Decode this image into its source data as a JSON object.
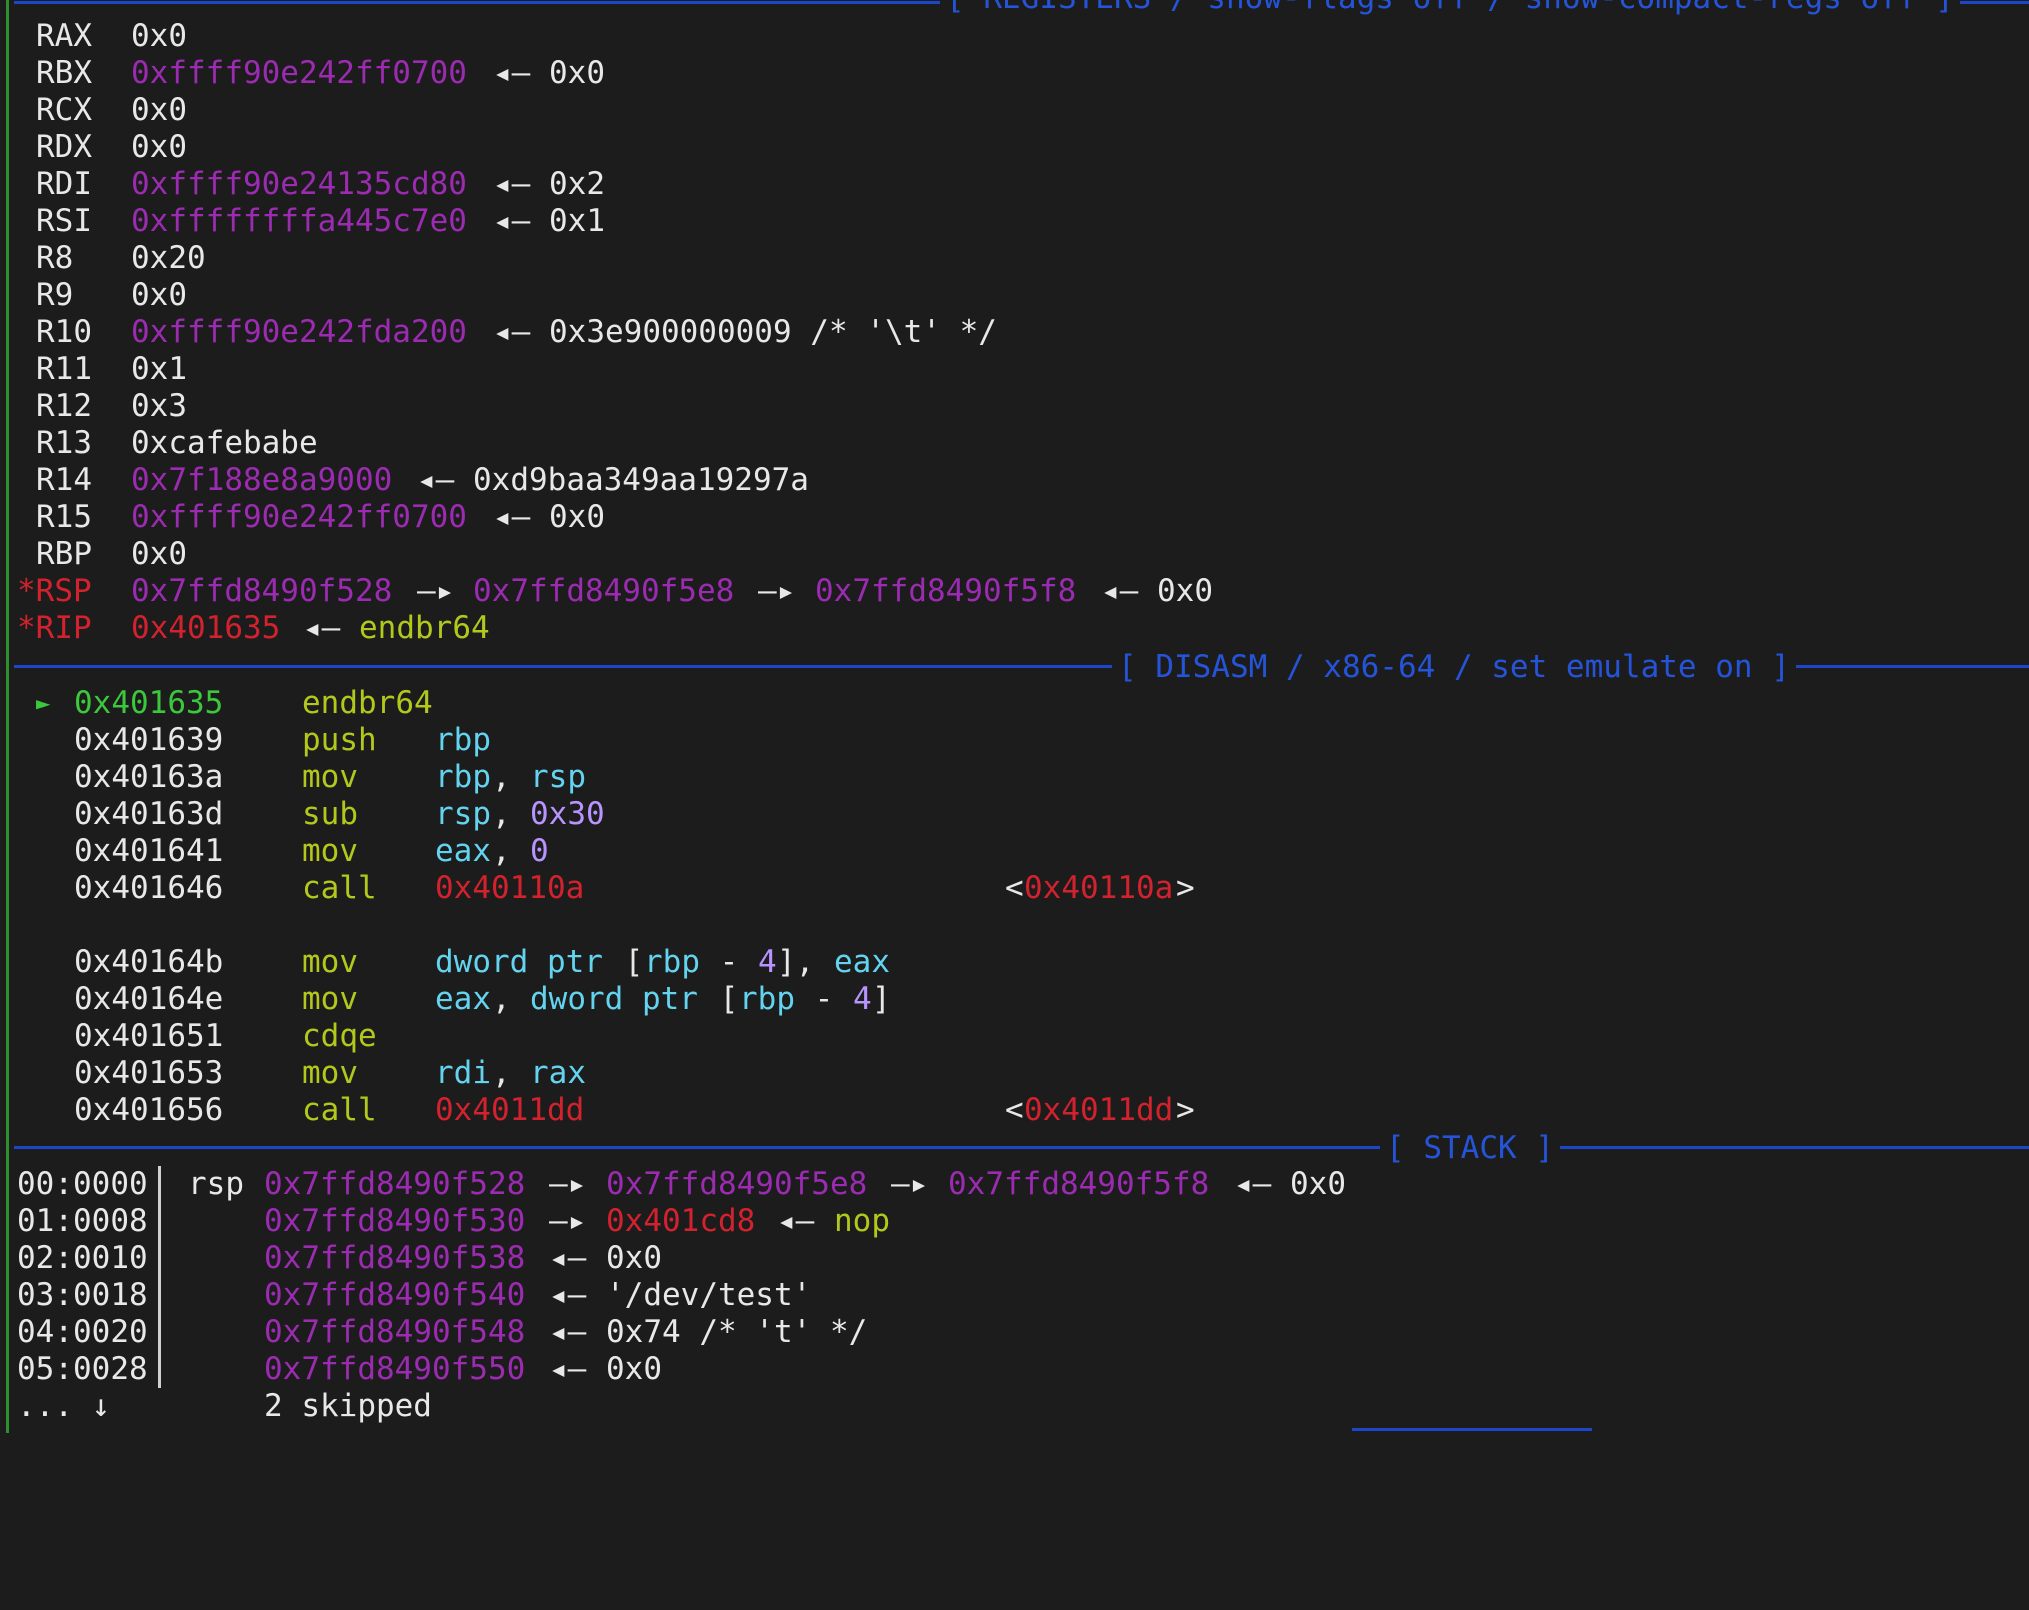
{
  "headers": {
    "registers": "[ REGISTERS / show-flags off / show-compact-regs off ]",
    "disasm": "[ DISASM / x86-64 / set emulate on ]",
    "stack": "[ STACK ]"
  },
  "registers": [
    {
      "name": "RAX",
      "value": "0x0"
    },
    {
      "name": "RBX",
      "value": "0xffff90e242ff0700",
      "arrow1": "◂—",
      "target": "0x0"
    },
    {
      "name": "RCX",
      "value": "0x0"
    },
    {
      "name": "RDX",
      "value": "0x0"
    },
    {
      "name": "RDI",
      "value": "0xffff90e24135cd80",
      "arrow1": "◂—",
      "target": "0x2"
    },
    {
      "name": "RSI",
      "value": "0xffffffffa445c7e0",
      "arrow1": "◂—",
      "target": "0x1"
    },
    {
      "name": "R8",
      "value": "0x20"
    },
    {
      "name": "R9",
      "value": "0x0"
    },
    {
      "name": "R10",
      "value": "0xffff90e242fda200",
      "arrow1": "◂—",
      "target": "0x3e900000009 /* '\\t' */"
    },
    {
      "name": "R11",
      "value": "0x1"
    },
    {
      "name": "R12",
      "value": "0x3"
    },
    {
      "name": "R13",
      "value": "0xcafebabe"
    },
    {
      "name": "R14",
      "value": "0x7f188e8a9000",
      "arrow1": "◂—",
      "target": "0xd9baa349aa19297a"
    },
    {
      "name": "R15",
      "value": "0xffff90e242ff0700",
      "arrow1": "◂—",
      "target": "0x0"
    },
    {
      "name": "RBP",
      "value": "0x0"
    },
    {
      "name": "*RSP",
      "value": "0x7ffd8490f528",
      "arrow1": "—▸",
      "ptr2": "0x7ffd8490f5e8",
      "arrow2": "—▸",
      "ptr3": "0x7ffd8490f5f8",
      "arrow3": "◂—",
      "target": "0x0"
    },
    {
      "name": "*RIP",
      "value": "0x401635",
      "arrow1": "◂—",
      "target": "endbr64"
    }
  ],
  "disasm": {
    "marker": "►",
    "lines": [
      {
        "addr": "0x401635",
        "mnem": "endbr64",
        "op1": "",
        "op1b": "",
        "op2": "",
        "op2b": "",
        "op3": "",
        "comment_open": "",
        "comment_addr": "",
        "comment_close": ""
      },
      {
        "addr": "0x401639",
        "mnem": "push",
        "op1": "rbp"
      },
      {
        "addr": "0x40163a",
        "mnem": "mov",
        "op1": "rbp",
        "sep": ", ",
        "op2": "rsp"
      },
      {
        "addr": "0x40163d",
        "mnem": "sub",
        "op1": "rsp",
        "sep": ", ",
        "num": "0x30"
      },
      {
        "addr": "0x401641",
        "mnem": "mov",
        "op1": "eax",
        "sep": ", ",
        "num": "0"
      },
      {
        "addr": "0x401646",
        "mnem": "call",
        "call": "0x40110a",
        "comment_open": "<",
        "comment_addr": "0x40110a",
        "comment_close": ">"
      },
      {
        "addr": "0x40164b",
        "mnem": "mov",
        "mem1": "dword ptr",
        "br_open": " [",
        "reg_in": "rbp",
        "minus": " - ",
        "off": "4",
        "br_close": "], ",
        "op2": "eax"
      },
      {
        "addr": "0x40164e",
        "mnem": "mov",
        "op1": "eax",
        "sep": ", ",
        "mem1": "dword ptr",
        "br_open": " [",
        "reg_in": "rbp",
        "minus": " - ",
        "off": "4",
        "br_close": "]"
      },
      {
        "addr": "0x401651",
        "mnem": "cdqe"
      },
      {
        "addr": "0x401653",
        "mnem": "mov",
        "op1": "rdi",
        "sep": ", ",
        "op2": "rax"
      },
      {
        "addr": "0x401656",
        "mnem": "call",
        "call": "0x4011dd",
        "comment_open": "<",
        "comment_addr": "0x4011dd",
        "comment_close": ">"
      }
    ]
  },
  "stack": {
    "rows": [
      {
        "idx": "00:0000",
        "label": "rsp",
        "addr": "0x7ffd8490f528",
        "a1": "—▸",
        "p2": "0x7ffd8490f5e8",
        "a2": "—▸",
        "p3": "0x7ffd8490f5f8",
        "a3": "◂—",
        "val": "0x0"
      },
      {
        "idx": "01:0008",
        "label": "",
        "addr": "0x7ffd8490f530",
        "a1": "—▸",
        "p2red": "0x401cd8",
        "a2": "◂—",
        "valyellow": "nop"
      },
      {
        "idx": "02:0010",
        "label": "",
        "addr": "0x7ffd8490f538",
        "a1": "◂—",
        "val": "0x0"
      },
      {
        "idx": "03:0018",
        "label": "",
        "addr": "0x7ffd8490f540",
        "a1": "◂—",
        "val": "'/dev/test'"
      },
      {
        "idx": "04:0020",
        "label": "",
        "addr": "0x7ffd8490f548",
        "a1": "◂—",
        "val": "0x74 /* 't' */"
      },
      {
        "idx": "05:0028",
        "label": "",
        "addr": "0x7ffd8490f550",
        "a1": "◂—",
        "val": "0x0"
      }
    ],
    "skip": {
      "dots": "... ↓",
      "text": "2 skipped"
    }
  },
  "colors": {
    "pointer": "#9b2bb0",
    "code": "#d2222e",
    "instruction": "#b2c81b",
    "current": "#3cc83c",
    "register": "#63d3ef",
    "separator": "#1a46c8"
  }
}
